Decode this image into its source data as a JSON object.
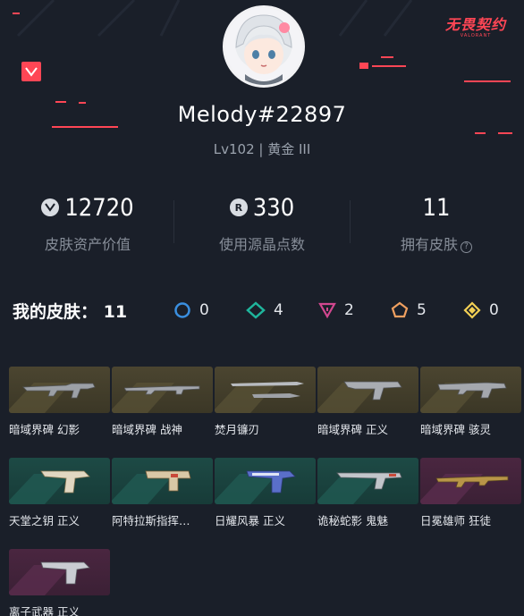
{
  "brand": {
    "logo_cn": "无畏契约",
    "logo_en": "VALORANT"
  },
  "profile": {
    "username": "Melody#22897",
    "level_rank": "Lv102 | 黄金 III"
  },
  "stats": [
    {
      "value": "12720",
      "label": "皮肤资产价值",
      "icon": "valorant-points-icon"
    },
    {
      "value": "330",
      "label": "使用源晶点数",
      "icon": "radianite-icon"
    },
    {
      "value": "11",
      "label": "拥有皮肤",
      "icon": "help-icon"
    }
  ],
  "skins_summary": {
    "title": "我的皮肤：",
    "count": "11",
    "tiers": [
      {
        "icon": "select-tier-icon",
        "color": "#3a8fe0",
        "count": "0"
      },
      {
        "icon": "deluxe-tier-icon",
        "color": "#1fb59c",
        "count": "4"
      },
      {
        "icon": "premium-tier-icon",
        "color": "#d2478f",
        "count": "2"
      },
      {
        "icon": "exclusive-tier-icon",
        "color": "#f0a060",
        "count": "5"
      },
      {
        "icon": "ultra-tier-icon",
        "color": "#f2cf54",
        "count": "0"
      }
    ]
  },
  "skins": [
    {
      "name": "暗域界碑 幻影",
      "tier": "gold"
    },
    {
      "name": "暗域界碑 战神",
      "tier": "gold"
    },
    {
      "name": "焚月镰刃",
      "tier": "gold"
    },
    {
      "name": "暗域界碑 正义",
      "tier": "gold"
    },
    {
      "name": "暗域界碑 骇灵",
      "tier": "gold"
    },
    {
      "name": "天堂之钥 正义",
      "tier": "green"
    },
    {
      "name": "阿特拉斯指挥…",
      "tier": "green"
    },
    {
      "name": "日耀风暴 正义",
      "tier": "green"
    },
    {
      "name": "诡秘蛇影 鬼魅",
      "tier": "green"
    },
    {
      "name": "日冕雄师 狂徒",
      "tier": "purple"
    },
    {
      "name": "离子武器 正义",
      "tier": "purple"
    }
  ]
}
